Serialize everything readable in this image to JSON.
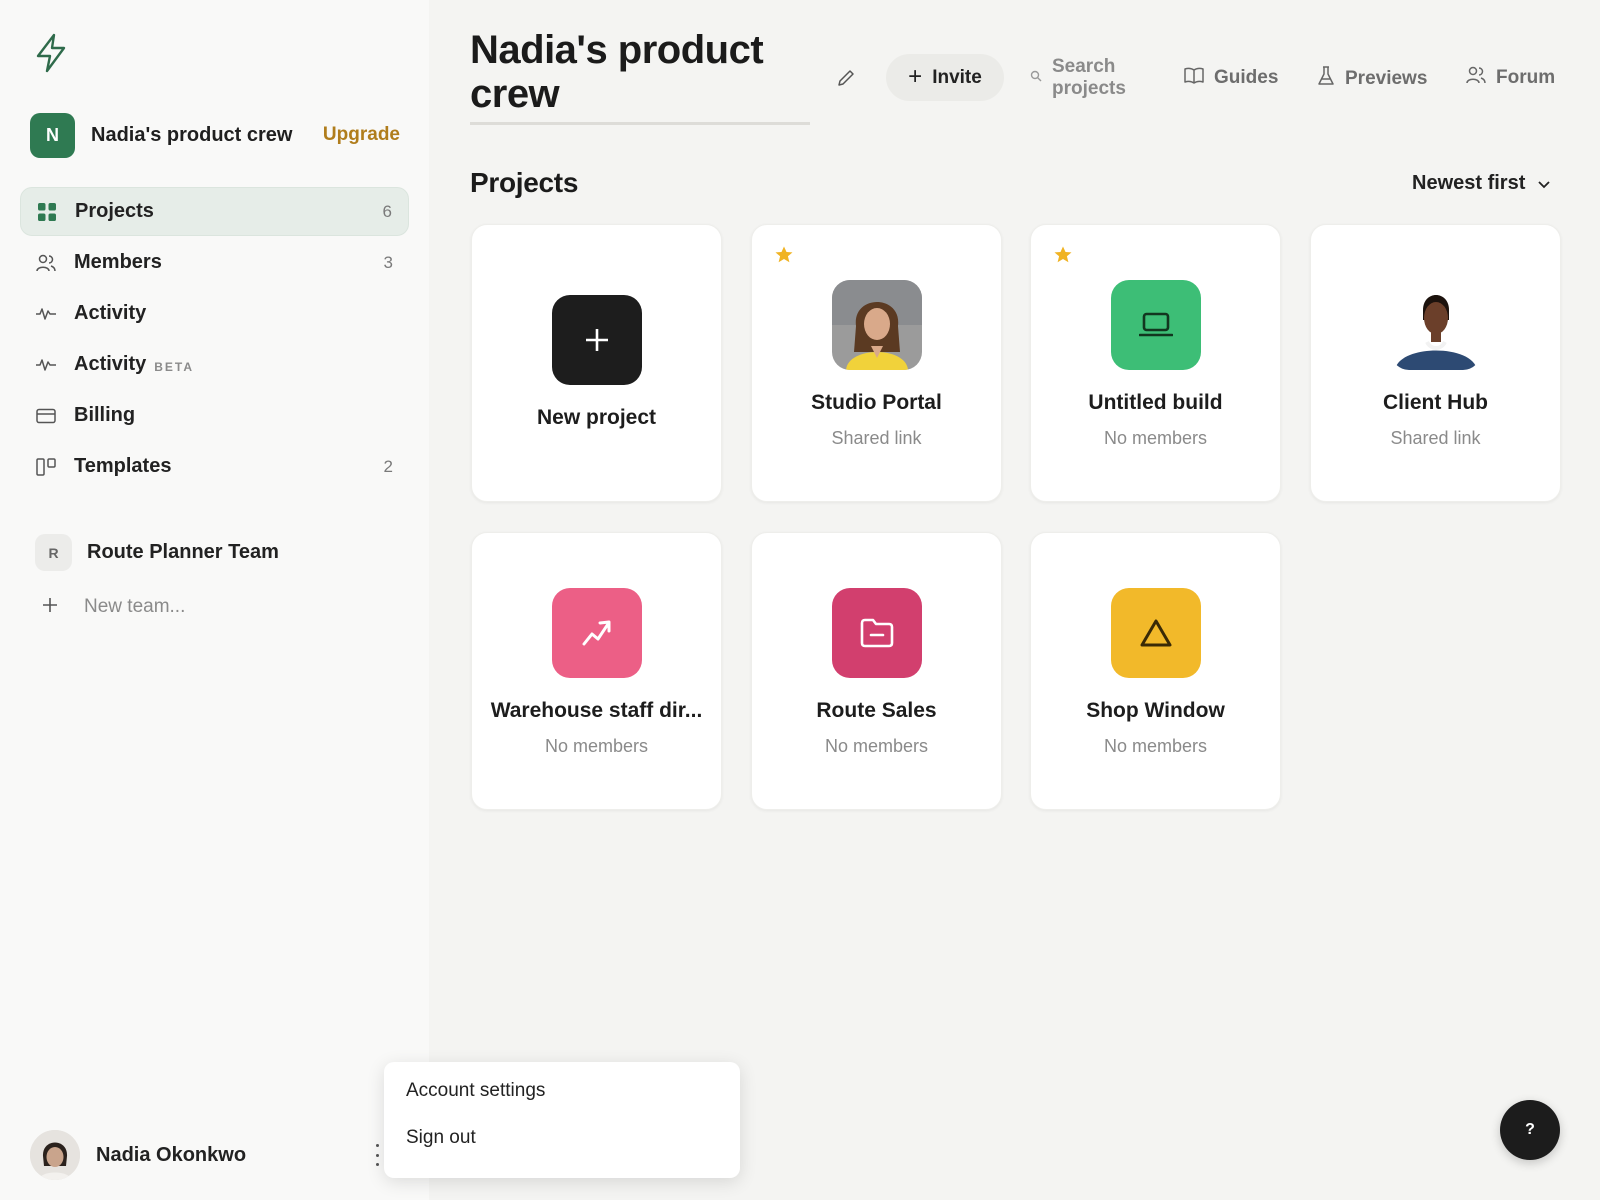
{
  "sidebar": {
    "logo_icon": "lightning-icon",
    "team": {
      "initial": "N",
      "name": "Nadia's product crew",
      "upgrade_label": "Upgrade"
    },
    "nav": [
      {
        "label": "Projects",
        "count": "6",
        "icon": "grid-icon",
        "active": true
      },
      {
        "label": "Members",
        "count": "3",
        "icon": "users-icon"
      },
      {
        "label": "Activity",
        "icon": "pulse-icon"
      },
      {
        "label": "Activity",
        "badge": "BETA",
        "icon": "pulse-icon"
      },
      {
        "label": "Billing",
        "icon": "credit-card-icon"
      },
      {
        "label": "Templates",
        "count": "2",
        "icon": "templates-icon"
      }
    ],
    "other_team": {
      "initial": "R",
      "name": "Route Planner Team"
    },
    "new_team_label": "New team...",
    "user": {
      "name": "Nadia Okonkwo"
    }
  },
  "user_menu": {
    "items": [
      "Account settings",
      "Sign out"
    ]
  },
  "header": {
    "title": "Nadia's product crew",
    "invite_label": "Invite",
    "search_label": "Search projects",
    "links": [
      "Guides",
      "Previews",
      "Forum"
    ]
  },
  "projects": {
    "title": "Projects",
    "sort_label": "Newest first",
    "cards": [
      {
        "name": "New project",
        "kind": "new"
      },
      {
        "name": "Studio Portal",
        "subtitle": "Shared link",
        "starred": true,
        "thumb": "woman-photo"
      },
      {
        "name": "Untitled build",
        "subtitle": "No members",
        "starred": true,
        "thumb": "laptop-icon",
        "color": "#3dbe76"
      },
      {
        "name": "Client Hub",
        "subtitle": "Shared link",
        "thumb": "man-photo"
      },
      {
        "name": "Warehouse staff dir...",
        "subtitle": "No members",
        "thumb": "chart-arrow-icon",
        "color": "#ec5f86"
      },
      {
        "name": "Route Sales",
        "subtitle": "No members",
        "thumb": "folder-icon",
        "color": "#d23f6e"
      },
      {
        "name": "Shop Window",
        "subtitle": "No members",
        "thumb": "triangle-icon",
        "color": "#f2b92a"
      }
    ]
  },
  "help_label": "?",
  "colors": {
    "accent_green": "#2f7a52",
    "upgrade_gold": "#b07d1c",
    "star": "#f0b323"
  }
}
